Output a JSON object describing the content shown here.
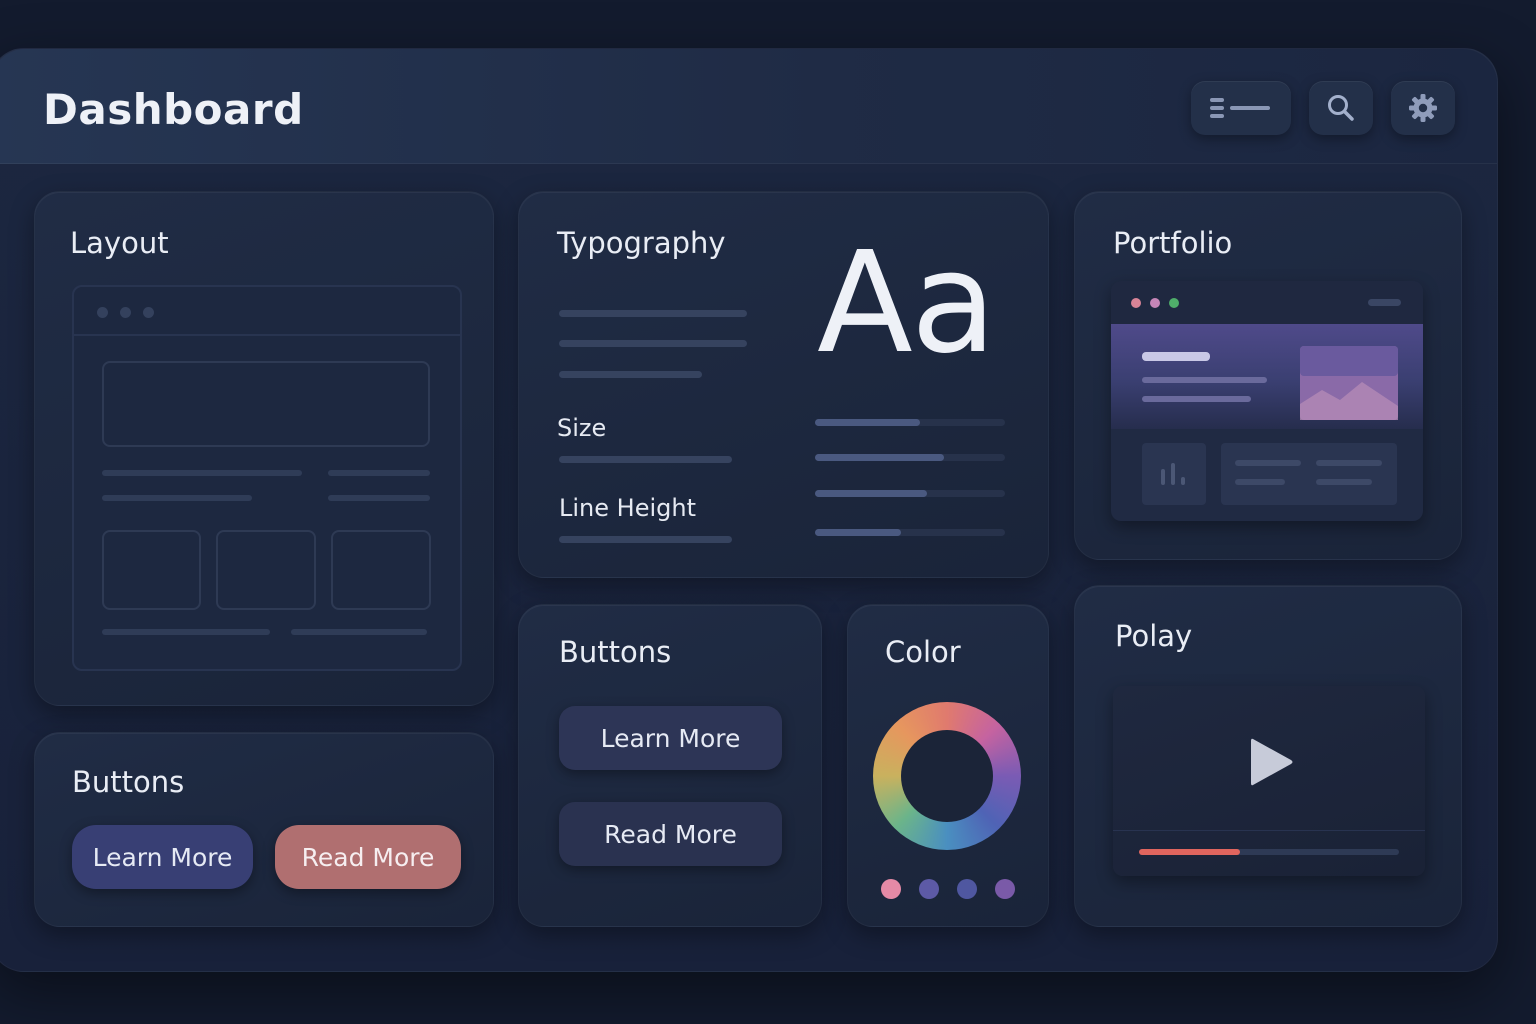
{
  "header": {
    "title": "Dashboard"
  },
  "icons": {
    "menu": "list-menu-icon",
    "search": "search-icon",
    "settings": "gear-icon",
    "play": "play-icon"
  },
  "cards": {
    "layout": {
      "title": "Layout"
    },
    "typography": {
      "title": "Typography",
      "sample": "Aa",
      "size_label": "Size",
      "line_height_label": "Line Height",
      "sliders": [
        0.55,
        0.68,
        0.59,
        0.45
      ]
    },
    "portfolio": {
      "title": "Portfolio"
    },
    "buttons_left": {
      "title": "Buttons",
      "learn_more": "Learn More",
      "read_more": "Read More"
    },
    "buttons_mid": {
      "title": "Buttons",
      "learn_more": "Learn More",
      "read_more": "Read More"
    },
    "color": {
      "title": "Color",
      "swatches": [
        "#e58aa6",
        "#5d5aa6",
        "#4f57a0",
        "#7a5aa8"
      ]
    },
    "play": {
      "title": "Polay",
      "progress": 0.39
    }
  },
  "colors": {
    "background": "#131b2e",
    "card": "#1e2941",
    "learn_more_button": "#3b4279",
    "read_more_button": "#b5706f",
    "progress_accent": "#e0655e"
  }
}
